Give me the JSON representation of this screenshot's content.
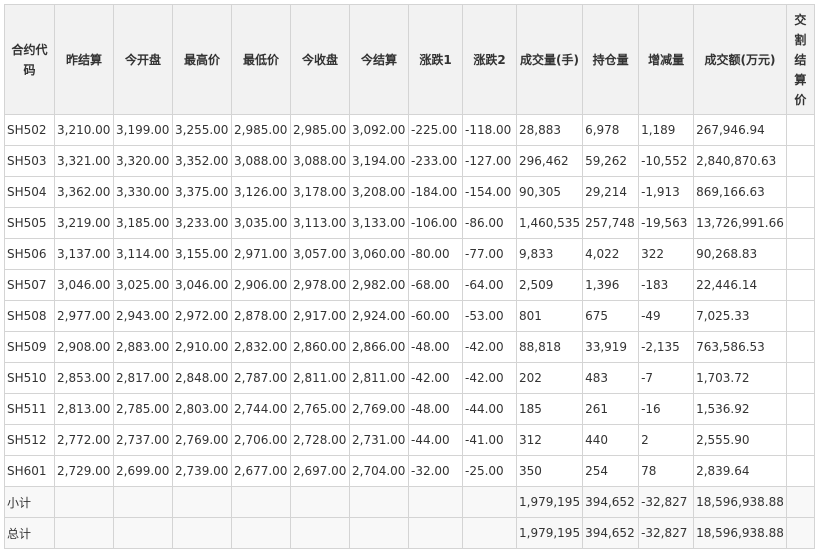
{
  "headers": [
    {
      "key": "code",
      "label": "合约代码"
    },
    {
      "key": "prev_settle",
      "label": "昨结算"
    },
    {
      "key": "open",
      "label": "今开盘"
    },
    {
      "key": "high",
      "label": "最高价"
    },
    {
      "key": "low",
      "label": "最低价"
    },
    {
      "key": "close",
      "label": "今收盘"
    },
    {
      "key": "settle",
      "label": "今结算"
    },
    {
      "key": "chg1",
      "label": "涨跌1"
    },
    {
      "key": "chg2",
      "label": "涨跌2"
    },
    {
      "key": "volume",
      "label": "成交量(手)"
    },
    {
      "key": "oi",
      "label": "持仓量"
    },
    {
      "key": "oi_chg",
      "label": "增减量"
    },
    {
      "key": "turnover",
      "label": "成交额(万元)"
    },
    {
      "key": "delivery",
      "label": "交割结算价"
    }
  ],
  "rows": [
    [
      "SH502",
      "3,210.00",
      "3,199.00",
      "3,255.00",
      "2,985.00",
      "2,985.00",
      "3,092.00",
      "-225.00",
      "-118.00",
      "28,883",
      "6,978",
      "1,189",
      "267,946.94",
      ""
    ],
    [
      "SH503",
      "3,321.00",
      "3,320.00",
      "3,352.00",
      "3,088.00",
      "3,088.00",
      "3,194.00",
      "-233.00",
      "-127.00",
      "296,462",
      "59,262",
      "-10,552",
      "2,840,870.63",
      ""
    ],
    [
      "SH504",
      "3,362.00",
      "3,330.00",
      "3,375.00",
      "3,126.00",
      "3,178.00",
      "3,208.00",
      "-184.00",
      "-154.00",
      "90,305",
      "29,214",
      "-1,913",
      "869,166.63",
      ""
    ],
    [
      "SH505",
      "3,219.00",
      "3,185.00",
      "3,233.00",
      "3,035.00",
      "3,113.00",
      "3,133.00",
      "-106.00",
      "-86.00",
      "1,460,535",
      "257,748",
      "-19,563",
      "13,726,991.66",
      ""
    ],
    [
      "SH506",
      "3,137.00",
      "3,114.00",
      "3,155.00",
      "2,971.00",
      "3,057.00",
      "3,060.00",
      "-80.00",
      "-77.00",
      "9,833",
      "4,022",
      "322",
      "90,268.83",
      ""
    ],
    [
      "SH507",
      "3,046.00",
      "3,025.00",
      "3,046.00",
      "2,906.00",
      "2,978.00",
      "2,982.00",
      "-68.00",
      "-64.00",
      "2,509",
      "1,396",
      "-183",
      "22,446.14",
      ""
    ],
    [
      "SH508",
      "2,977.00",
      "2,943.00",
      "2,972.00",
      "2,878.00",
      "2,917.00",
      "2,924.00",
      "-60.00",
      "-53.00",
      "801",
      "675",
      "-49",
      "7,025.33",
      ""
    ],
    [
      "SH509",
      "2,908.00",
      "2,883.00",
      "2,910.00",
      "2,832.00",
      "2,860.00",
      "2,866.00",
      "-48.00",
      "-42.00",
      "88,818",
      "33,919",
      "-2,135",
      "763,586.53",
      ""
    ],
    [
      "SH510",
      "2,853.00",
      "2,817.00",
      "2,848.00",
      "2,787.00",
      "2,811.00",
      "2,811.00",
      "-42.00",
      "-42.00",
      "202",
      "483",
      "-7",
      "1,703.72",
      ""
    ],
    [
      "SH511",
      "2,813.00",
      "2,785.00",
      "2,803.00",
      "2,744.00",
      "2,765.00",
      "2,769.00",
      "-48.00",
      "-44.00",
      "185",
      "261",
      "-16",
      "1,536.92",
      ""
    ],
    [
      "SH512",
      "2,772.00",
      "2,737.00",
      "2,769.00",
      "2,706.00",
      "2,728.00",
      "2,731.00",
      "-44.00",
      "-41.00",
      "312",
      "440",
      "2",
      "2,555.90",
      ""
    ],
    [
      "SH601",
      "2,729.00",
      "2,699.00",
      "2,739.00",
      "2,677.00",
      "2,697.00",
      "2,704.00",
      "-32.00",
      "-25.00",
      "350",
      "254",
      "78",
      "2,839.64",
      ""
    ]
  ],
  "summary": [
    {
      "label": "小计",
      "volume": "1,979,195",
      "oi": "394,652",
      "oi_chg": "-32,827",
      "turnover": "18,596,938.88"
    },
    {
      "label": "总计",
      "volume": "1,979,195",
      "oi": "394,652",
      "oi_chg": "-32,827",
      "turnover": "18,596,938.88"
    }
  ]
}
